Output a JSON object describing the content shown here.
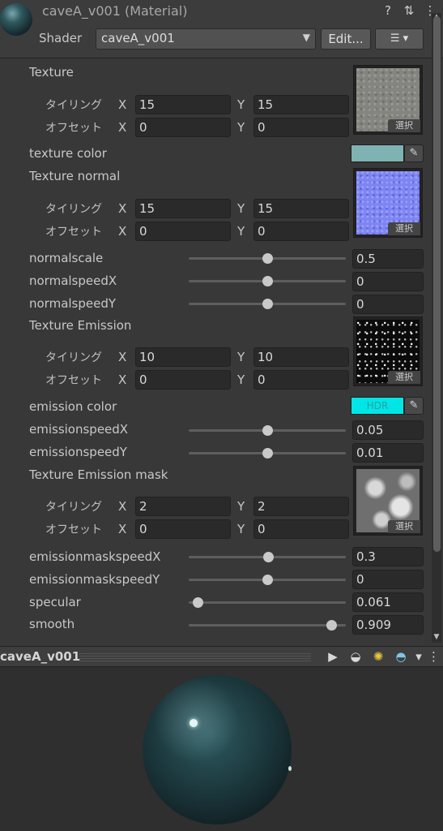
{
  "header": {
    "title": "caveA_v001 (Material)",
    "shader_label": "Shader",
    "shader_value": "caveA_v001",
    "edit_label": "Edit...",
    "icons": [
      "help-icon",
      "sliders-icon",
      "more-icon"
    ]
  },
  "textures": [
    {
      "name": "Texture",
      "tiling_label": "タイリング",
      "offset_label": "オフセット",
      "tiling_x": "15",
      "tiling_y": "15",
      "offset_x": "0",
      "offset_y": "0",
      "select_label": "選択"
    },
    {
      "name": "Texture normal",
      "tiling_label": "タイリング",
      "offset_label": "オフセット",
      "tiling_x": "15",
      "tiling_y": "15",
      "offset_x": "0",
      "offset_y": "0",
      "select_label": "選択"
    },
    {
      "name": "Texture Emission",
      "tiling_label": "タイリング",
      "offset_label": "オフセット",
      "tiling_x": "10",
      "tiling_y": "10",
      "offset_x": "0",
      "offset_y": "0",
      "select_label": "選択"
    },
    {
      "name": "Texture Emission mask",
      "tiling_label": "タイリング",
      "offset_label": "オフセット",
      "tiling_x": "2",
      "tiling_y": "2",
      "offset_x": "0",
      "offset_y": "0",
      "select_label": "選択"
    }
  ],
  "axes": {
    "x": "X",
    "y": "Y"
  },
  "colors": {
    "texture_color": {
      "label": "texture color",
      "hex": "#7fb2b2"
    },
    "emission_color": {
      "label": "emission color",
      "hex": "#00e6e6",
      "badge": "HDR"
    }
  },
  "sliders": [
    {
      "label": "normalscale",
      "value": "0.5",
      "fraction": 0.5
    },
    {
      "label": "normalspeedX",
      "value": "0",
      "fraction": 0.5
    },
    {
      "label": "normalspeedY",
      "value": "0",
      "fraction": 0.5
    },
    {
      "label": "emissionspeedX",
      "value": "0.05",
      "fraction": 0.5
    },
    {
      "label": "emissionspeedY",
      "value": "0.01",
      "fraction": 0.5
    },
    {
      "label": "emissionmaskspeedX",
      "value": "0.3",
      "fraction": 0.51
    },
    {
      "label": "emissionmaskspeedY",
      "value": "0",
      "fraction": 0.5
    },
    {
      "label": "specular",
      "value": "0.061",
      "fraction": 0.06
    },
    {
      "label": "smooth",
      "value": "0.909",
      "fraction": 0.91
    }
  ],
  "preview": {
    "title": "caveA_v001",
    "icons": [
      "play-icon",
      "sphere-mesh-icon",
      "lights-icon",
      "skybox-icon",
      "dropdown-icon",
      "more-icon"
    ]
  }
}
